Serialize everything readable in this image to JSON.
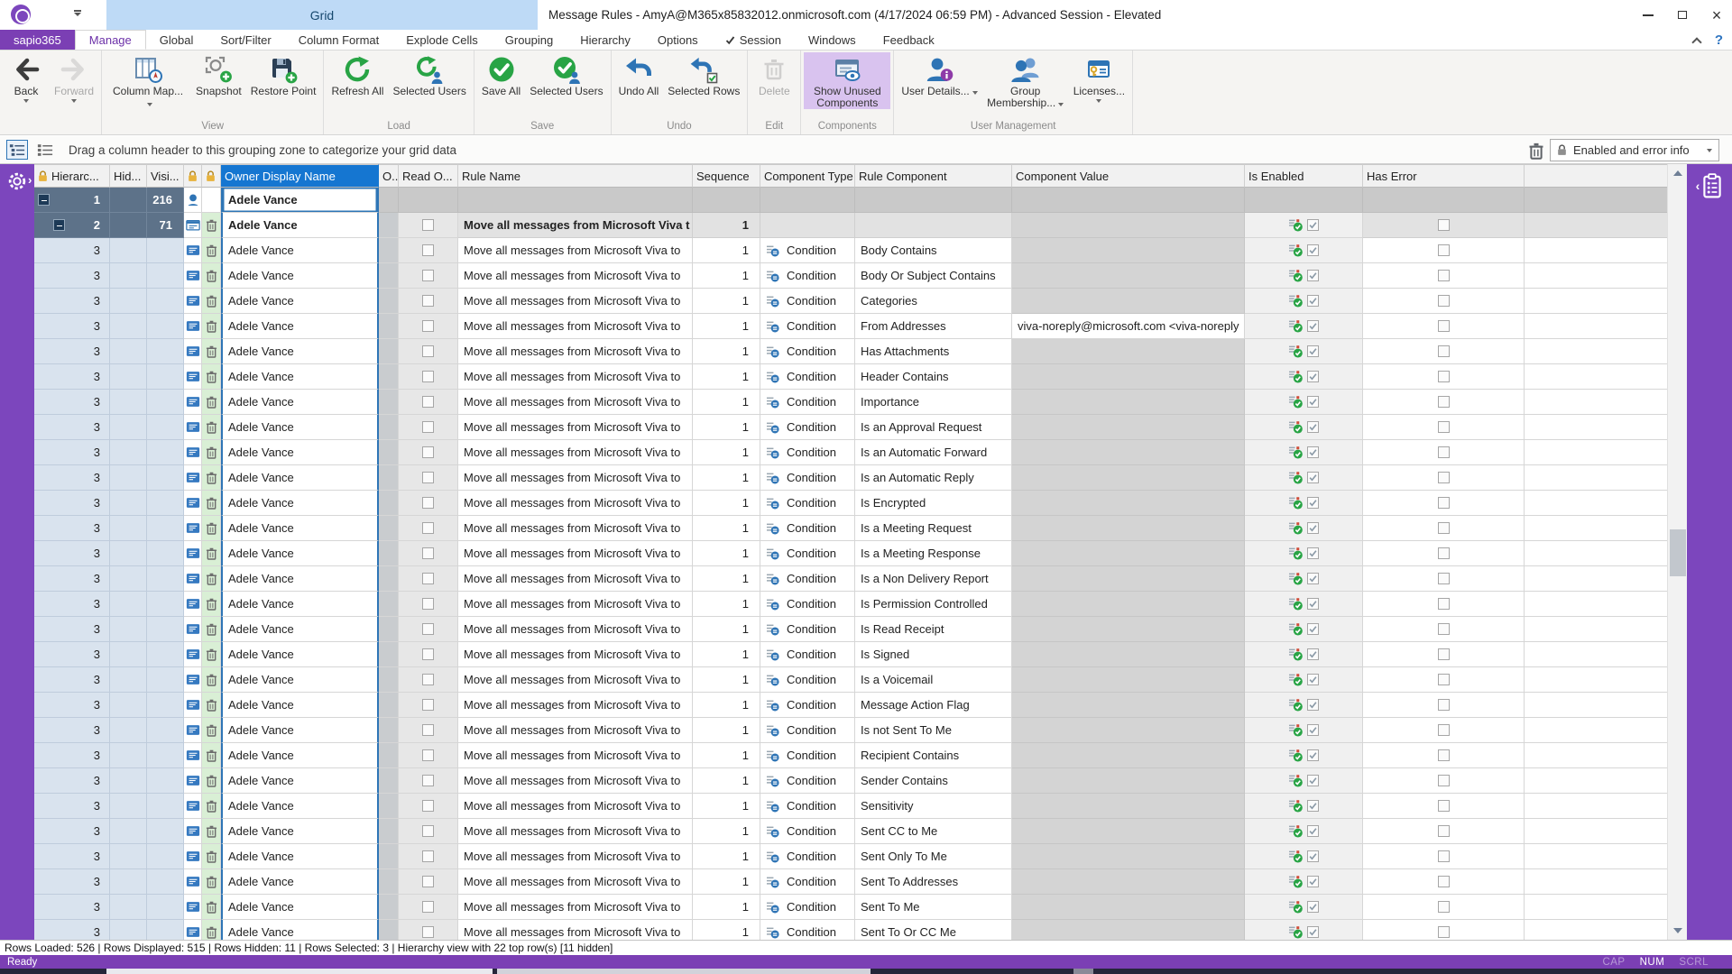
{
  "window": {
    "title": "Message Rules - AmyA@M365x85832012.onmicrosoft.com (4/17/2024 06:59 PM) - Advanced Session - Elevated",
    "context_tab": "Grid"
  },
  "tabs": [
    {
      "label": "sapio365",
      "type": "brand"
    },
    {
      "label": "Manage",
      "type": "active"
    },
    {
      "label": "Global"
    },
    {
      "label": "Sort/Filter"
    },
    {
      "label": "Column Format"
    },
    {
      "label": "Explode Cells"
    },
    {
      "label": "Grouping"
    },
    {
      "label": "Hierarchy"
    },
    {
      "label": "Options",
      "type": ""
    },
    {
      "label": "Session",
      "check": true
    },
    {
      "label": "Windows"
    },
    {
      "label": "Feedback"
    }
  ],
  "ribbon": {
    "groups": [
      {
        "label": "",
        "buttons": [
          {
            "label": "Back",
            "icon": "back-arrow-icon",
            "caret": "below"
          },
          {
            "label": "Forward",
            "icon": "forward-arrow-icon",
            "caret": "below",
            "disabled": true
          }
        ]
      },
      {
        "label": "View",
        "buttons": [
          {
            "label": "Column Map...",
            "icon": "column-map-icon",
            "caret": "inline"
          },
          {
            "label": "Snapshot",
            "icon": "snapshot-icon"
          },
          {
            "label": "Restore Point",
            "icon": "restore-point-icon"
          }
        ]
      },
      {
        "label": "Load",
        "buttons": [
          {
            "label": "Refresh All",
            "icon": "refresh-icon"
          },
          {
            "label": "Selected Users",
            "icon": "refresh-users-icon"
          }
        ]
      },
      {
        "label": "Save",
        "buttons": [
          {
            "label": "Save All",
            "icon": "save-icon"
          },
          {
            "label": "Selected Users",
            "icon": "save-users-icon"
          }
        ]
      },
      {
        "label": "Undo",
        "buttons": [
          {
            "label": "Undo All",
            "icon": "undo-icon"
          },
          {
            "label": "Selected Rows",
            "icon": "undo-rows-icon"
          }
        ]
      },
      {
        "label": "Edit",
        "buttons": [
          {
            "label": "Delete",
            "icon": "delete-icon",
            "disabled": true
          }
        ]
      },
      {
        "label": "Components",
        "buttons": [
          {
            "label": "Show Unused Components",
            "icon": "show-unused-icon",
            "active": true
          }
        ]
      },
      {
        "label": "User Management",
        "buttons": [
          {
            "label": "User Details...",
            "icon": "user-details-icon",
            "caret": "inline"
          },
          {
            "label": "Group Membership...",
            "icon": "group-membership-icon",
            "caret": "inline"
          },
          {
            "label": "Licenses...",
            "icon": "licenses-icon",
            "caret": "below"
          }
        ]
      }
    ]
  },
  "grouping_bar": {
    "hint": "Drag a column header to this grouping zone to categorize your grid data",
    "view_selector": "Enabled and error info"
  },
  "grid": {
    "columns": [
      {
        "key": "hier",
        "label": "Hierarc...",
        "lock": true
      },
      {
        "key": "hid",
        "label": "Hid..."
      },
      {
        "key": "visi",
        "label": "Visi..."
      },
      {
        "key": "ica",
        "label": "",
        "lock": true
      },
      {
        "key": "icb",
        "label": "",
        "lock": true
      },
      {
        "key": "owner",
        "label": "Owner Display Name",
        "selected": true
      },
      {
        "key": "o",
        "label": "O..."
      },
      {
        "key": "read",
        "label": "Read O..."
      },
      {
        "key": "rule",
        "label": "Rule Name"
      },
      {
        "key": "seq",
        "label": "Sequence"
      },
      {
        "key": "ctype",
        "label": "Component Type"
      },
      {
        "key": "rcomp",
        "label": "Rule Component"
      },
      {
        "key": "cval",
        "label": "Component Value"
      },
      {
        "key": "isen",
        "label": "Is Enabled"
      },
      {
        "key": "haserr",
        "label": "Has Error"
      }
    ],
    "group_rows": [
      {
        "level": 1,
        "hierarchy": "1",
        "visible": "216",
        "owner": "Adele Vance"
      },
      {
        "level": 2,
        "hierarchy": "2",
        "visible": "71",
        "owner": "Adele Vance",
        "rule_name": "Move all messages from Microsoft Viva t",
        "sequence": "1"
      }
    ],
    "detail_defaults": {
      "hierarchy": "3",
      "owner": "Adele Vance",
      "rule_name": "Move all messages from Microsoft Viva to",
      "sequence": "1",
      "component_type": "Condition"
    },
    "detail_rows": [
      {
        "rule_component": "Body Contains"
      },
      {
        "rule_component": "Body Or Subject Contains"
      },
      {
        "rule_component": "Categories"
      },
      {
        "rule_component": "From Addresses",
        "component_value": "viva-noreply@microsoft.com <viva-noreply"
      },
      {
        "rule_component": "Has Attachments"
      },
      {
        "rule_component": "Header Contains"
      },
      {
        "rule_component": "Importance"
      },
      {
        "rule_component": "Is an Approval Request"
      },
      {
        "rule_component": "Is an Automatic Forward"
      },
      {
        "rule_component": "Is an Automatic Reply"
      },
      {
        "rule_component": "Is Encrypted"
      },
      {
        "rule_component": "Is a Meeting Request"
      },
      {
        "rule_component": "Is a Meeting Response"
      },
      {
        "rule_component": "Is a Non Delivery Report"
      },
      {
        "rule_component": "Is Permission Controlled"
      },
      {
        "rule_component": "Is Read Receipt"
      },
      {
        "rule_component": "Is Signed"
      },
      {
        "rule_component": "Is a Voicemail"
      },
      {
        "rule_component": "Message Action Flag"
      },
      {
        "rule_component": "Is not Sent To Me"
      },
      {
        "rule_component": "Recipient Contains"
      },
      {
        "rule_component": "Sender Contains"
      },
      {
        "rule_component": "Sensitivity"
      },
      {
        "rule_component": "Sent CC to Me"
      },
      {
        "rule_component": "Sent Only To Me"
      },
      {
        "rule_component": "Sent To Addresses"
      },
      {
        "rule_component": "Sent To Me"
      },
      {
        "rule_component": "Sent To Or CC Me"
      }
    ]
  },
  "status_bar": {
    "text": "Rows Loaded: 526 | Rows Displayed: 515 | Rows Hidden: 11 | Rows Selected: 3 | Hierarchy view with 22 top row(s) [11 hidden]"
  },
  "ready_bar": {
    "text": "Ready",
    "indicators": [
      {
        "label": "CAP",
        "active": false
      },
      {
        "label": "NUM",
        "active": true
      },
      {
        "label": "SCRL",
        "active": false
      }
    ]
  },
  "colors": {
    "brand_purple": "#7c46bd",
    "header_selected_blue": "#1576d1",
    "accent_green": "#28a445",
    "accent_blue": "#2e74b5",
    "selected_row_slate": "#5d7289"
  }
}
